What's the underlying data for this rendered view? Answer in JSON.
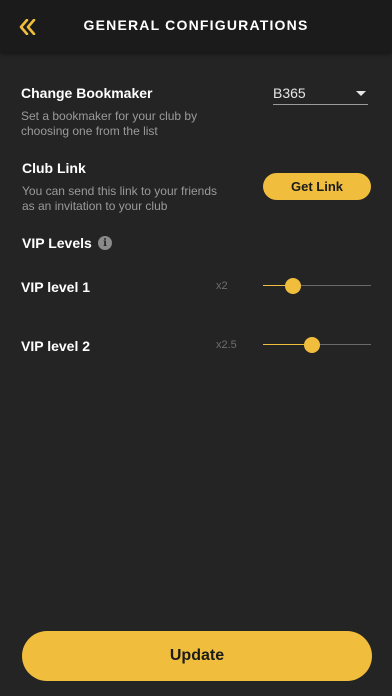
{
  "header": {
    "title": "GENERAL CONFIGURATIONS",
    "back_icon": "double-chevron-left-icon"
  },
  "bookmaker": {
    "title": "Change Bookmaker",
    "description": "Set a bookmaker for your club by choosing one from the list",
    "selected": "B365"
  },
  "club_link": {
    "title": "Club Link",
    "description": "You can send this link to your friends as an invitation to your club",
    "button_label": "Get Link"
  },
  "vip": {
    "title": "VIP Levels",
    "info_icon": "info-icon",
    "levels": [
      {
        "label": "VIP level 1",
        "multiplier": "x2",
        "value": 0.28
      },
      {
        "label": "VIP level 2",
        "multiplier": "x2.5",
        "value": 0.45
      }
    ]
  },
  "update_label": "Update",
  "colors": {
    "accent": "#f0be3c",
    "background": "#242424",
    "header": "#1b1b1b"
  }
}
